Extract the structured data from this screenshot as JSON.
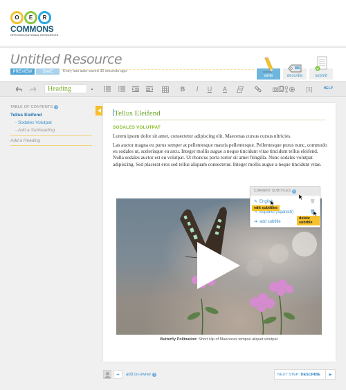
{
  "logo": {
    "letters": [
      "O",
      "E",
      "R"
    ],
    "colors": [
      "#f2c12e",
      "#8cc63f",
      "#29a8e0"
    ],
    "name": "COMMONS",
    "tagline": "OPEN EDUCATIONAL RESOURCES"
  },
  "header": {
    "title": "Untitled Resource",
    "preview_label": "PREVIEW",
    "save_label": "SAVE",
    "autosave_text": "Entry last auto-saved 30 seconds ago.",
    "steps": [
      {
        "label": "write",
        "icon": "pencil-icon",
        "active": true
      },
      {
        "label": "describe",
        "icon": "tag-icon",
        "active": false
      },
      {
        "label": "submit",
        "icon": "document-check-icon",
        "active": false
      }
    ]
  },
  "toolbar": {
    "heading_value": "Heading",
    "footnote_label": "[1]",
    "help_label": "HELP",
    "buttons": [
      "undo-icon",
      "redo-icon",
      "bullet-list-icon",
      "numbered-list-icon",
      "indent-icon",
      "outdent-icon",
      "table-icon",
      "bold-icon",
      "italic-icon",
      "underline-icon",
      "text-color-icon",
      "clear-format-icon",
      "link-icon",
      "media-icons",
      "footnote-icon"
    ]
  },
  "toc": {
    "heading": "TABLE OF CONTENTS",
    "items": [
      {
        "label": "Tellus Eleifend",
        "level": 1
      },
      {
        "label": "- Sodales Volutpat",
        "level": 2
      },
      {
        "label": "- Add a Subheading",
        "level": 2,
        "placeholder": true
      },
      {
        "label": "Add a Heading",
        "level": 1,
        "placeholder": true
      }
    ]
  },
  "document": {
    "title": "Tellus Eleifend",
    "subheading": "SODALES VOLUTPAT",
    "paragraph1": "Lorem ipsum dolor sit amet, consectetur adipiscing elit. Maecenas cursus cursus ultricies.",
    "paragraph2": "Las auctor magna eu purus semper at pellentesque mauris pellentesque. Pellentesque purus nunc, commodo eu sodales ut, scelerisque eu arcu. Integer mollis augue a neque tincidunt vitae tincidunt tellus eleifend. Nulla sodales auctor est eu volutpat. Ut rhoncus porta tortor sit amet fringilla. Nunc sodales volutpat adipiscing. Sed placerat eros sed tellus aliquam consectetur. Integer mollis augue a neque tincidunt vitae.",
    "caption_bold": "Butterfly Pollination:",
    "caption_text": " Short clip of Maecenas tempus aliquet volutpat."
  },
  "subtitles": {
    "heading": "CURRENT SUBTITLES",
    "items": [
      {
        "label": "English"
      },
      {
        "label": "Español (Spanish)"
      }
    ],
    "add_label": "add subtitle",
    "tooltip_edit": "edit subtitles",
    "tooltip_delete": "delete subtitle"
  },
  "footer": {
    "add_coowner_label": "add co-owner",
    "next_step_prefix": "NEXT STEP:",
    "next_step_name": "DESCRIBE"
  }
}
